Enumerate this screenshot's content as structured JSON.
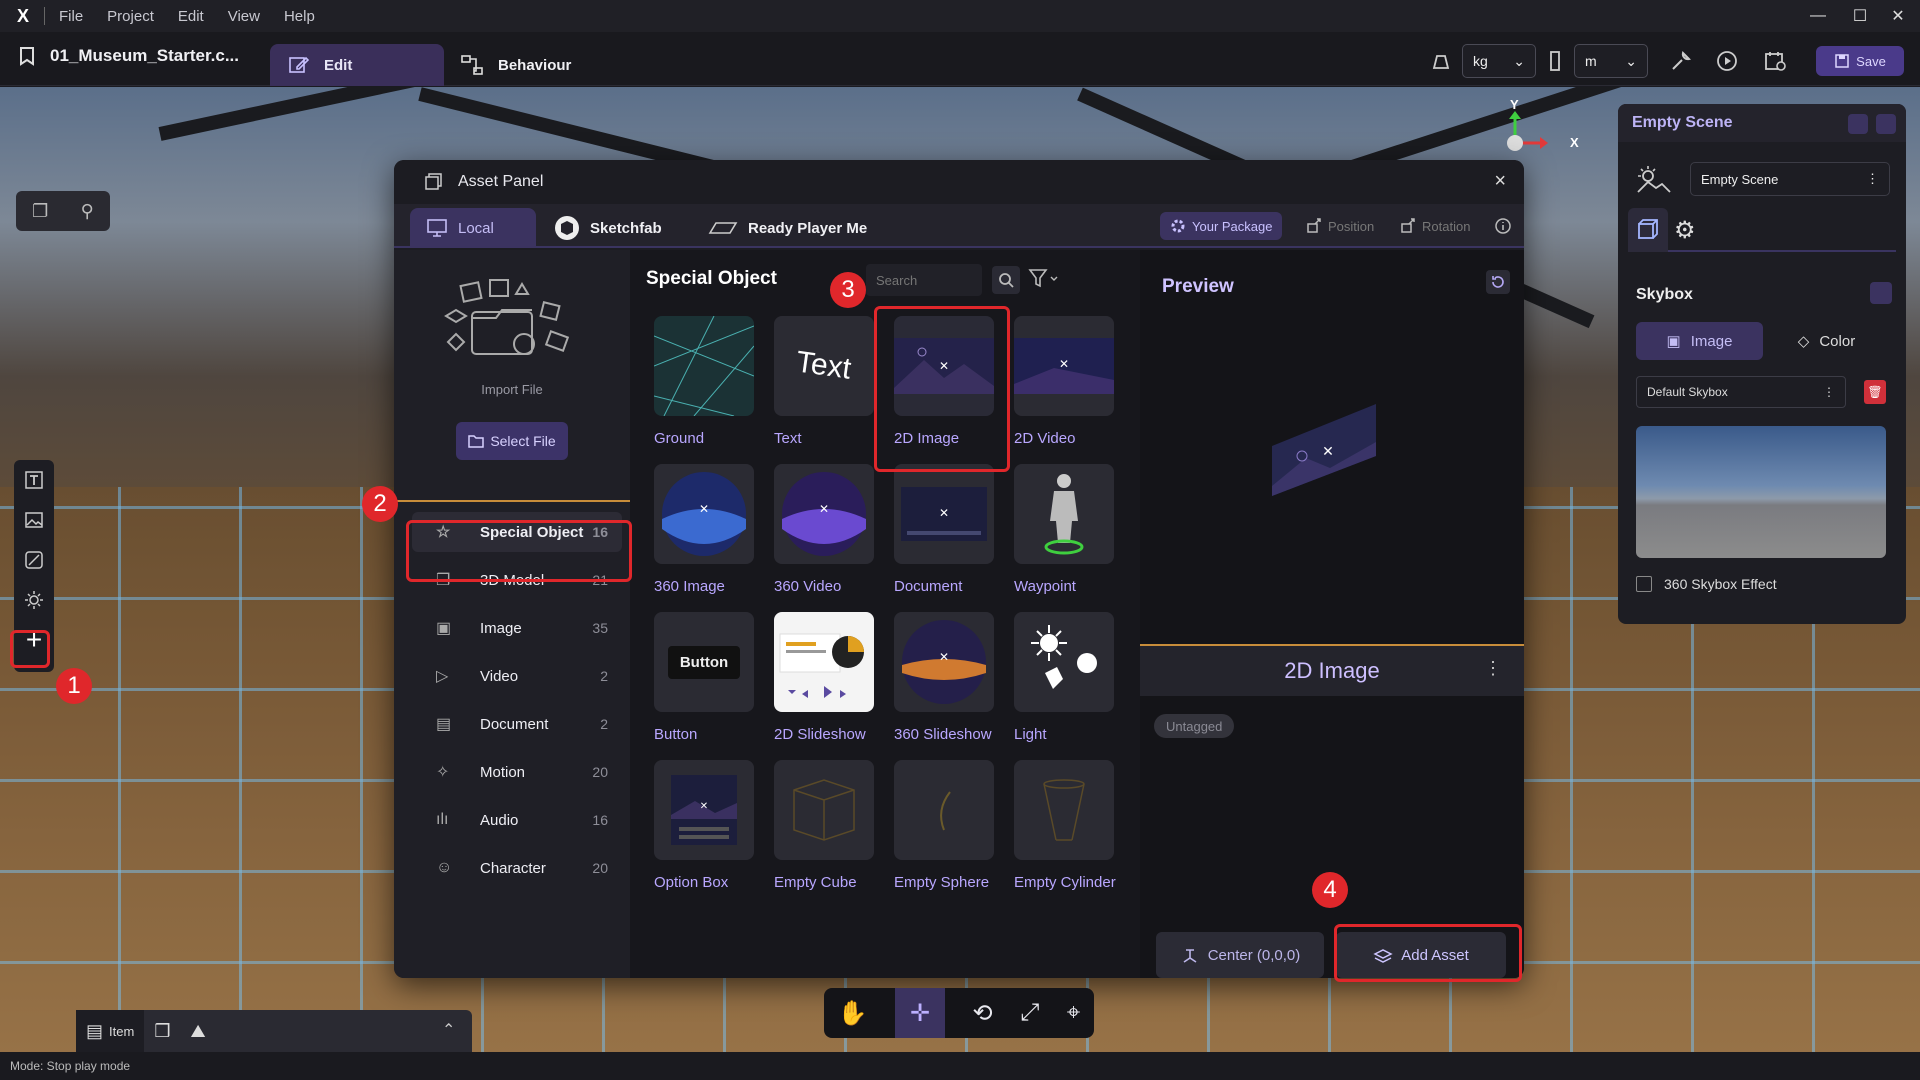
{
  "menubar": {
    "logo": "X",
    "items": [
      "File",
      "Project",
      "Edit",
      "View",
      "Help"
    ],
    "window_controls": {
      "minimize": "—",
      "maximize": "☐",
      "close": "✕"
    }
  },
  "toolbar": {
    "project_name": "01_Museum_Starter.c...",
    "tab_edit": "Edit",
    "tab_behaviour": "Behaviour",
    "mass_unit": "kg",
    "length_unit": "m",
    "save_label": "Save"
  },
  "asset_panel": {
    "title": "Asset Panel",
    "close": "×",
    "tabs": [
      "Local",
      "Sketchfab",
      "Ready Player Me"
    ],
    "chips": {
      "your_package": "Your Package",
      "position": "Position",
      "rotation": "Rotation"
    },
    "import_label": "Import File",
    "select_file": "Select File",
    "categories": [
      {
        "label": "Special Object",
        "count": "16"
      },
      {
        "label": "3D Model",
        "count": "21"
      },
      {
        "label": "Image",
        "count": "35"
      },
      {
        "label": "Video",
        "count": "2"
      },
      {
        "label": "Document",
        "count": "2"
      },
      {
        "label": "Motion",
        "count": "20"
      },
      {
        "label": "Audio",
        "count": "16"
      },
      {
        "label": "Character",
        "count": "20"
      }
    ],
    "grid_title": "Special Object",
    "search_placeholder": "Search",
    "tiles": [
      "Ground",
      "Text",
      "2D Image",
      "2D Video",
      "360 Image",
      "360 Video",
      "Document",
      "Waypoint",
      "Button",
      "2D Slideshow",
      "360 Slideshow",
      "Light",
      "Option Box",
      "Empty Cube",
      "Empty Sphere",
      "Empty Cylinder"
    ],
    "text_tile_glyph": "Text",
    "button_tile_glyph": "Button",
    "preview_title": "Preview",
    "selected_name": "2D Image",
    "tag": "Untagged",
    "center_label": "Center (0,0,0)",
    "add_asset_label": "Add Asset"
  },
  "annotations": [
    "1",
    "2",
    "3",
    "4"
  ],
  "gizmo": {
    "y": "Y",
    "x": "X"
  },
  "scene_panel": {
    "title": "Empty Scene",
    "scene_value": "Empty Scene",
    "skybox_label": "Skybox",
    "opt_image": "Image",
    "opt_color": "Color",
    "skybox_value": "Default Skybox",
    "effect_label": "360 Skybox Effect"
  },
  "bottom": {
    "item_tab": "Item"
  },
  "status": "Mode: Stop play mode",
  "colors": {
    "accent": "#3b3360",
    "highlight_red": "#e0272b",
    "label_purple": "#b9a7ff"
  }
}
